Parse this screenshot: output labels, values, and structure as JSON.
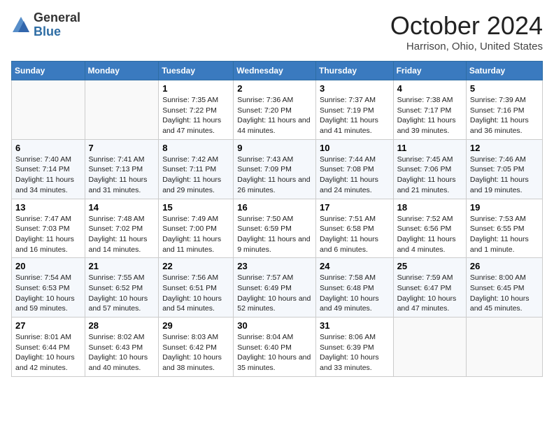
{
  "header": {
    "logo_line1": "General",
    "logo_line2": "Blue",
    "month_title": "October 2024",
    "location": "Harrison, Ohio, United States"
  },
  "days_of_week": [
    "Sunday",
    "Monday",
    "Tuesday",
    "Wednesday",
    "Thursday",
    "Friday",
    "Saturday"
  ],
  "weeks": [
    [
      {
        "day": "",
        "info": ""
      },
      {
        "day": "",
        "info": ""
      },
      {
        "day": "1",
        "info": "Sunrise: 7:35 AM\nSunset: 7:22 PM\nDaylight: 11 hours and 47 minutes."
      },
      {
        "day": "2",
        "info": "Sunrise: 7:36 AM\nSunset: 7:20 PM\nDaylight: 11 hours and 44 minutes."
      },
      {
        "day": "3",
        "info": "Sunrise: 7:37 AM\nSunset: 7:19 PM\nDaylight: 11 hours and 41 minutes."
      },
      {
        "day": "4",
        "info": "Sunrise: 7:38 AM\nSunset: 7:17 PM\nDaylight: 11 hours and 39 minutes."
      },
      {
        "day": "5",
        "info": "Sunrise: 7:39 AM\nSunset: 7:16 PM\nDaylight: 11 hours and 36 minutes."
      }
    ],
    [
      {
        "day": "6",
        "info": "Sunrise: 7:40 AM\nSunset: 7:14 PM\nDaylight: 11 hours and 34 minutes."
      },
      {
        "day": "7",
        "info": "Sunrise: 7:41 AM\nSunset: 7:13 PM\nDaylight: 11 hours and 31 minutes."
      },
      {
        "day": "8",
        "info": "Sunrise: 7:42 AM\nSunset: 7:11 PM\nDaylight: 11 hours and 29 minutes."
      },
      {
        "day": "9",
        "info": "Sunrise: 7:43 AM\nSunset: 7:09 PM\nDaylight: 11 hours and 26 minutes."
      },
      {
        "day": "10",
        "info": "Sunrise: 7:44 AM\nSunset: 7:08 PM\nDaylight: 11 hours and 24 minutes."
      },
      {
        "day": "11",
        "info": "Sunrise: 7:45 AM\nSunset: 7:06 PM\nDaylight: 11 hours and 21 minutes."
      },
      {
        "day": "12",
        "info": "Sunrise: 7:46 AM\nSunset: 7:05 PM\nDaylight: 11 hours and 19 minutes."
      }
    ],
    [
      {
        "day": "13",
        "info": "Sunrise: 7:47 AM\nSunset: 7:03 PM\nDaylight: 11 hours and 16 minutes."
      },
      {
        "day": "14",
        "info": "Sunrise: 7:48 AM\nSunset: 7:02 PM\nDaylight: 11 hours and 14 minutes."
      },
      {
        "day": "15",
        "info": "Sunrise: 7:49 AM\nSunset: 7:00 PM\nDaylight: 11 hours and 11 minutes."
      },
      {
        "day": "16",
        "info": "Sunrise: 7:50 AM\nSunset: 6:59 PM\nDaylight: 11 hours and 9 minutes."
      },
      {
        "day": "17",
        "info": "Sunrise: 7:51 AM\nSunset: 6:58 PM\nDaylight: 11 hours and 6 minutes."
      },
      {
        "day": "18",
        "info": "Sunrise: 7:52 AM\nSunset: 6:56 PM\nDaylight: 11 hours and 4 minutes."
      },
      {
        "day": "19",
        "info": "Sunrise: 7:53 AM\nSunset: 6:55 PM\nDaylight: 11 hours and 1 minute."
      }
    ],
    [
      {
        "day": "20",
        "info": "Sunrise: 7:54 AM\nSunset: 6:53 PM\nDaylight: 10 hours and 59 minutes."
      },
      {
        "day": "21",
        "info": "Sunrise: 7:55 AM\nSunset: 6:52 PM\nDaylight: 10 hours and 57 minutes."
      },
      {
        "day": "22",
        "info": "Sunrise: 7:56 AM\nSunset: 6:51 PM\nDaylight: 10 hours and 54 minutes."
      },
      {
        "day": "23",
        "info": "Sunrise: 7:57 AM\nSunset: 6:49 PM\nDaylight: 10 hours and 52 minutes."
      },
      {
        "day": "24",
        "info": "Sunrise: 7:58 AM\nSunset: 6:48 PM\nDaylight: 10 hours and 49 minutes."
      },
      {
        "day": "25",
        "info": "Sunrise: 7:59 AM\nSunset: 6:47 PM\nDaylight: 10 hours and 47 minutes."
      },
      {
        "day": "26",
        "info": "Sunrise: 8:00 AM\nSunset: 6:45 PM\nDaylight: 10 hours and 45 minutes."
      }
    ],
    [
      {
        "day": "27",
        "info": "Sunrise: 8:01 AM\nSunset: 6:44 PM\nDaylight: 10 hours and 42 minutes."
      },
      {
        "day": "28",
        "info": "Sunrise: 8:02 AM\nSunset: 6:43 PM\nDaylight: 10 hours and 40 minutes."
      },
      {
        "day": "29",
        "info": "Sunrise: 8:03 AM\nSunset: 6:42 PM\nDaylight: 10 hours and 38 minutes."
      },
      {
        "day": "30",
        "info": "Sunrise: 8:04 AM\nSunset: 6:40 PM\nDaylight: 10 hours and 35 minutes."
      },
      {
        "day": "31",
        "info": "Sunrise: 8:06 AM\nSunset: 6:39 PM\nDaylight: 10 hours and 33 minutes."
      },
      {
        "day": "",
        "info": ""
      },
      {
        "day": "",
        "info": ""
      }
    ]
  ]
}
